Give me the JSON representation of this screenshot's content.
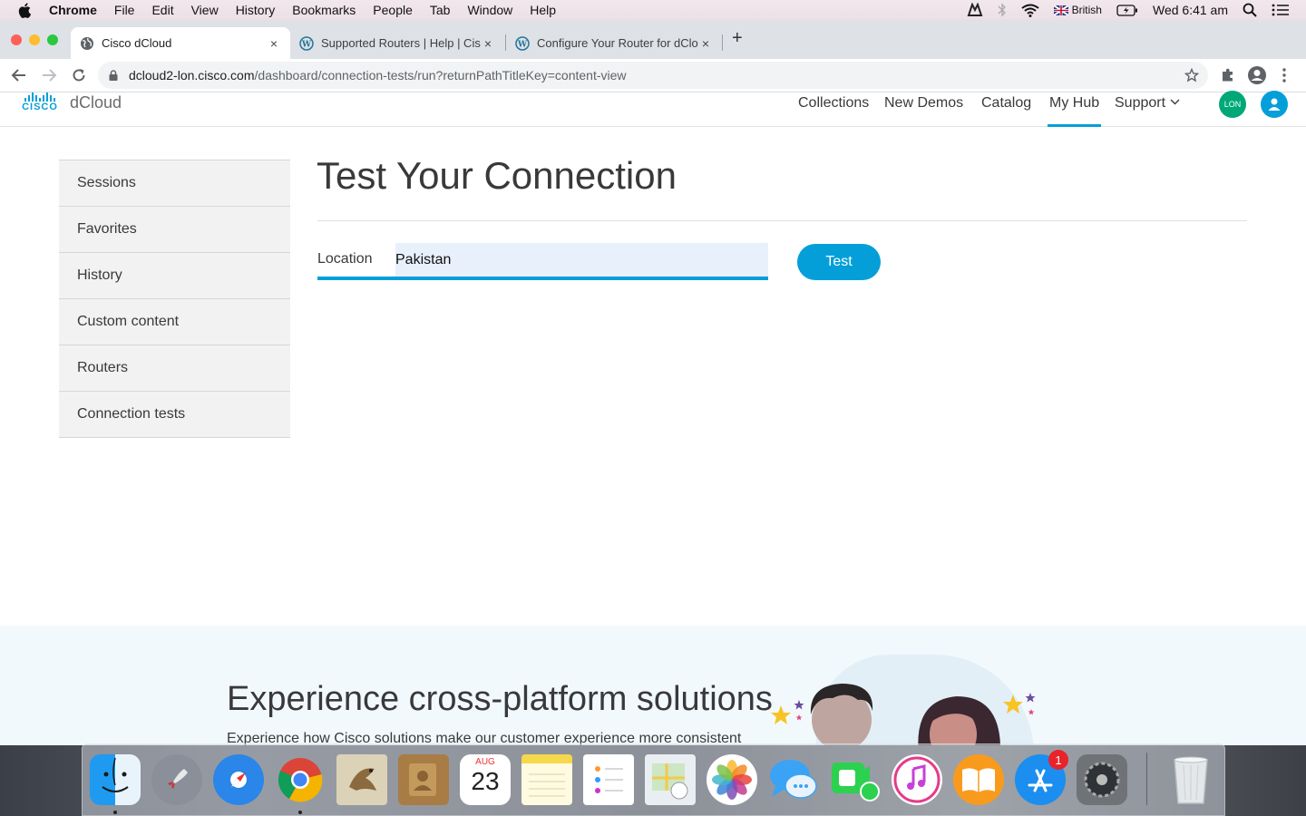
{
  "menubar": {
    "app": "Chrome",
    "items": [
      "File",
      "Edit",
      "View",
      "History",
      "Bookmarks",
      "People",
      "Tab",
      "Window",
      "Help"
    ],
    "input_source": "British",
    "clock": "Wed 6:41 am"
  },
  "tabs": [
    {
      "title": "Cisco dCloud",
      "close": "×"
    },
    {
      "title": "Supported Routers | Help | Cis",
      "close": "×"
    },
    {
      "title": "Configure Your Router for dClo",
      "close": "×"
    }
  ],
  "new_tab": "+",
  "address": {
    "host": "dcloud2-lon.cisco.com",
    "path": "/dashboard/connection-tests/run?returnPathTitleKey=content-view"
  },
  "site": {
    "logo_text": "CISCO",
    "brand": "dCloud",
    "nav": [
      {
        "label": "Collections"
      },
      {
        "label": "New Demos"
      },
      {
        "label": "Catalog"
      },
      {
        "label": "My Hub"
      },
      {
        "label": "Support"
      }
    ],
    "region_badge": "LON",
    "accent": "#049fd9"
  },
  "sidebar": {
    "items": [
      {
        "label": "Sessions"
      },
      {
        "label": "Favorites"
      },
      {
        "label": "History"
      },
      {
        "label": "Custom content"
      },
      {
        "label": "Routers"
      },
      {
        "label": "Connection tests"
      }
    ]
  },
  "main": {
    "title": "Test Your Connection",
    "location_label": "Location",
    "location_value": "Pakistan",
    "test_button": "Test"
  },
  "promo": {
    "heading": "Experience cross-platform solutions",
    "text": "Experience how Cisco solutions make our customer experience more consistent"
  },
  "dock": {
    "calendar_month": "AUG",
    "calendar_day": "23",
    "appstore_badge": "1"
  }
}
